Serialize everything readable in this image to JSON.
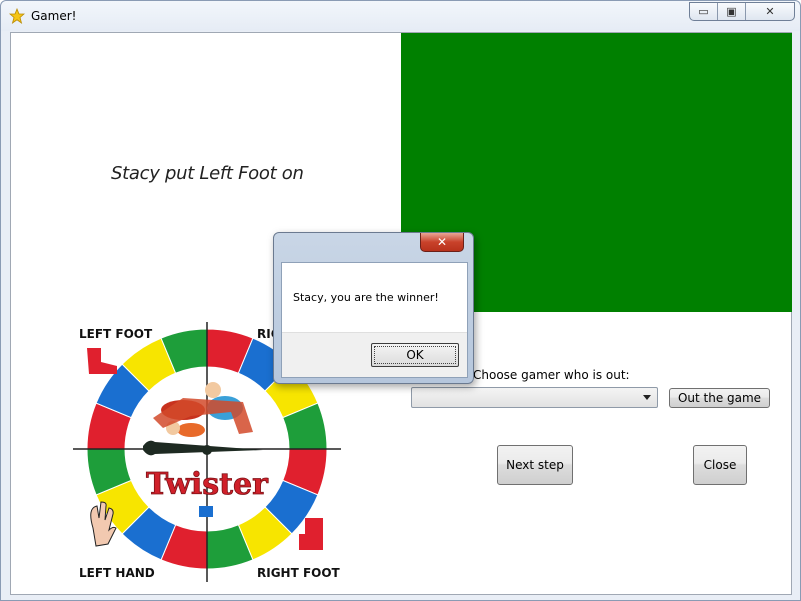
{
  "window": {
    "title": "Gamer!",
    "controls": {
      "minimize": "▭",
      "maximize": "▣",
      "close": "✕"
    }
  },
  "game": {
    "prompt": "Stacy put Left Foot on",
    "color_panel": "#008000",
    "out_label": "Choose gamer who is out:",
    "player_combo_value": "",
    "out_button": "Out the game",
    "next_button": "Next step",
    "close_button": "Close"
  },
  "spinner_board": {
    "labels": [
      "LEFT FOOT",
      "RIGHT HAND",
      "LEFT HAND",
      "RIGHT FOOT"
    ],
    "logo": "Twister",
    "colors": {
      "red": "#e0202e",
      "blue": "#1a6fd0",
      "yellow": "#f7e500",
      "green": "#1e9e3a"
    }
  },
  "dialog": {
    "message": "Stacy, you are the winner!",
    "ok_label": "OK",
    "close_icon": "✕"
  }
}
